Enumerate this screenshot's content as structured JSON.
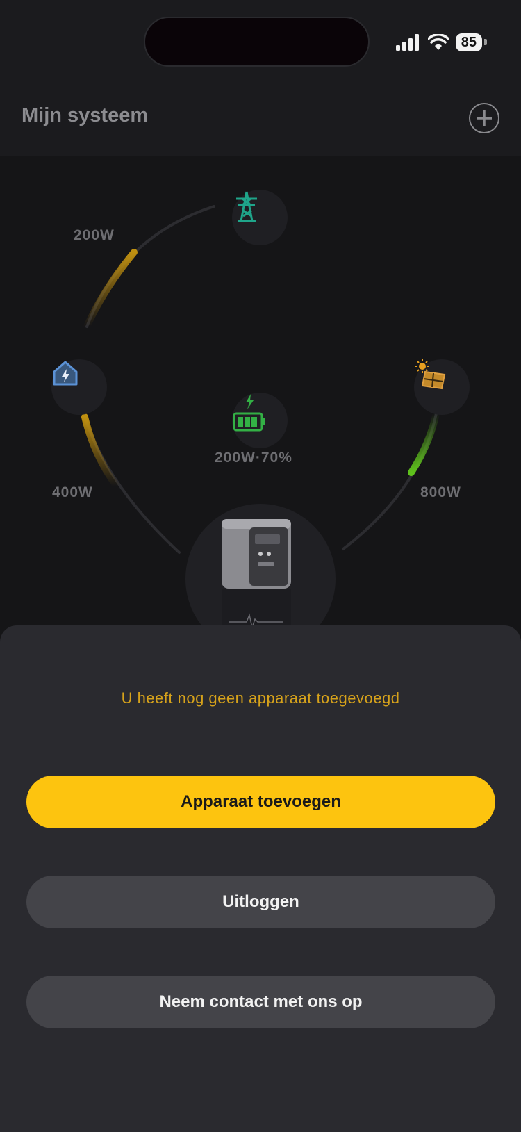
{
  "status_bar": {
    "battery_level": "85",
    "signal_icon": "cellular-signal-icon",
    "wifi_icon": "wifi-icon"
  },
  "header": {
    "title": "Mijn systeem",
    "add_icon": "plus-circle-icon"
  },
  "energy_flow": {
    "grid": {
      "icon": "power-tower-icon",
      "power": "200W"
    },
    "home": {
      "icon": "home-lightning-icon",
      "power": "400W"
    },
    "solar": {
      "icon": "solar-panel-icon",
      "power": "800W"
    },
    "battery": {
      "icon": "battery-charging-icon",
      "status": "200W·70%",
      "level_fraction": 0.7
    }
  },
  "sheet": {
    "message": "U heeft nog geen apparaat toegevoegd",
    "add_device_label": "Apparaat toevoegen",
    "logout_label": "Uitloggen",
    "contact_label": "Neem contact met ons op"
  },
  "colors": {
    "accent": "#fdc40f",
    "message": "#d6a21b",
    "grid_icon": "#1fa58a",
    "home_icon": "#4e86c8",
    "solar_flow": "#5fc21c",
    "home_flow": "#b8860b"
  }
}
